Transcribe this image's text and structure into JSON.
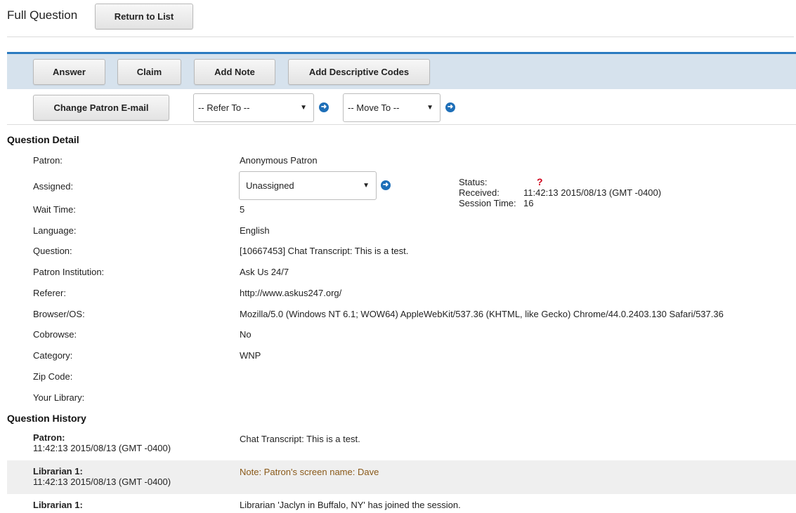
{
  "header": {
    "title": "Full Question",
    "return_button": "Return to List"
  },
  "toolbar": {
    "answer": "Answer",
    "claim": "Claim",
    "add_note": "Add Note",
    "add_descriptive_codes": "Add Descriptive Codes",
    "change_patron_email": "Change Patron E-mail",
    "refer_to": "-- Refer To --",
    "move_to": "-- Move To --"
  },
  "detail": {
    "section_title": "Question Detail",
    "patron_label": "Patron:",
    "patron_value": "Anonymous Patron",
    "assigned_label": "Assigned:",
    "assigned_value": "Unassigned",
    "wait_time_label": "Wait Time:",
    "wait_time_value": "5",
    "language_label": "Language:",
    "language_value": "English",
    "question_label": "Question:",
    "question_value": "[10667453] Chat Transcript: This is a test.",
    "institution_label": "Patron Institution:",
    "institution_value": "Ask Us 24/7",
    "referer_label": "Referer:",
    "referer_value": "http://www.askus247.org/",
    "browser_label": "Browser/OS:",
    "browser_value": "Mozilla/5.0 (Windows NT 6.1; WOW64) AppleWebKit/537.36 (KHTML, like Gecko) Chrome/44.0.2403.130 Safari/537.36",
    "cobrowse_label": "Cobrowse:",
    "cobrowse_value": "No",
    "category_label": "Category:",
    "category_value": "WNP",
    "zip_label": "Zip Code:",
    "zip_value": "",
    "library_label": "Your Library:",
    "library_value": ""
  },
  "status": {
    "status_label": "Status:",
    "status_value": "?",
    "received_label": "Received:",
    "received_value": "11:42:13 2015/08/13 (GMT -0400)",
    "session_label": "Session Time:",
    "session_value": "16"
  },
  "history": {
    "section_title": "Question History",
    "entries": [
      {
        "who": "Patron:",
        "time": "11:42:13 2015/08/13 (GMT -0400)",
        "message": "Chat Transcript: This is a test."
      },
      {
        "who": "Librarian 1:",
        "time": "11:42:13 2015/08/13 (GMT -0400)",
        "message": "Note: Patron's screen name: Dave"
      },
      {
        "who": "Librarian 1:",
        "time": "",
        "message": "Librarian 'Jaclyn in Buffalo, NY' has joined the session."
      }
    ]
  },
  "colors": {
    "accent": "#2b7bc0",
    "toolbar_bg": "#d6e2ed",
    "status_unknown": "#d0021b",
    "note_text": "#8a5a1a"
  }
}
